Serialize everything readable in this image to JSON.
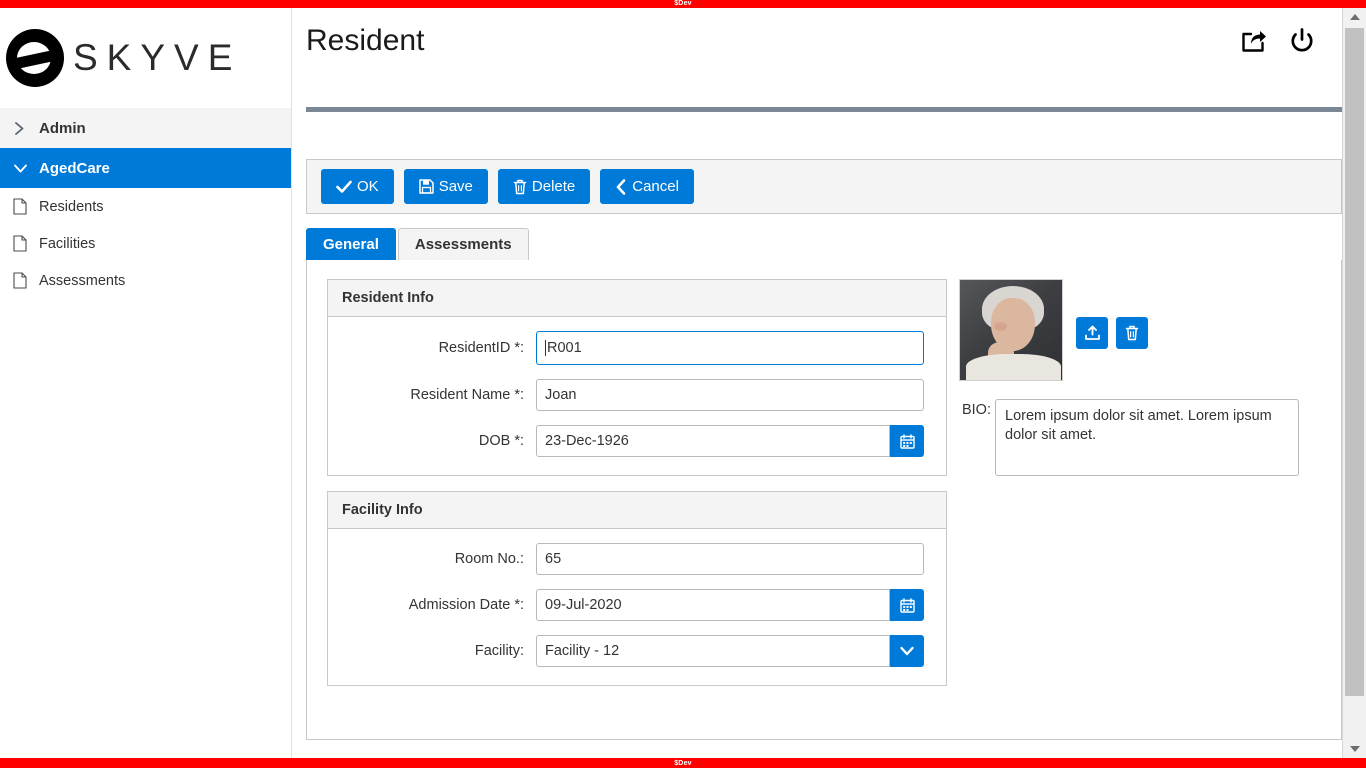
{
  "dev_banner": {
    "text": "$Dev"
  },
  "brand": {
    "name": "SKYVE",
    "logo_icon": "skyve-logo-icon"
  },
  "header": {
    "title": "Resident",
    "share_icon": "share-icon",
    "power_icon": "power-icon"
  },
  "sidebar": {
    "groups": [
      {
        "label": "Admin",
        "icon": "chevron-right-icon",
        "expanded": false,
        "active": false
      },
      {
        "label": "AgedCare",
        "icon": "chevron-down-icon",
        "expanded": true,
        "active": true
      }
    ],
    "items": [
      {
        "label": "Residents",
        "icon": "document-icon"
      },
      {
        "label": "Facilities",
        "icon": "document-icon"
      },
      {
        "label": "Assessments",
        "icon": "document-icon"
      }
    ]
  },
  "toolbar": {
    "ok_label": "OK",
    "save_label": "Save",
    "delete_label": "Delete",
    "cancel_label": "Cancel"
  },
  "tabs": [
    {
      "label": "General",
      "active": true
    },
    {
      "label": "Assessments",
      "active": false
    }
  ],
  "resident_info": {
    "title": "Resident Info",
    "fields": {
      "resident_id": {
        "label": "ResidentID *:",
        "value": "R001",
        "focused": true
      },
      "resident_name": {
        "label": "Resident Name *:",
        "value": "Joan"
      },
      "dob": {
        "label": "DOB *:",
        "value": "23-Dec-1926",
        "addon_icon": "calendar-icon"
      }
    }
  },
  "facility_info": {
    "title": "Facility Info",
    "fields": {
      "room_no": {
        "label": "Room No.:",
        "value": "65"
      },
      "admission_date": {
        "label": "Admission Date *:",
        "value": "09-Jul-2020",
        "addon_icon": "calendar-icon"
      },
      "facility": {
        "label": "Facility:",
        "value": "Facility - 12",
        "addon_icon": "chevron-down-icon"
      }
    }
  },
  "photo": {
    "alt": "resident-photo",
    "upload_icon": "upload-icon",
    "delete_icon": "trash-icon"
  },
  "bio": {
    "label": "BIO:",
    "value": "Lorem ipsum dolor sit amet. Lorem ipsum dolor sit amet."
  },
  "colors": {
    "accent": "#007ad9",
    "dev_banner": "#fe0000",
    "rule": "#7b8794",
    "panel_header": "#f4f4f4"
  }
}
